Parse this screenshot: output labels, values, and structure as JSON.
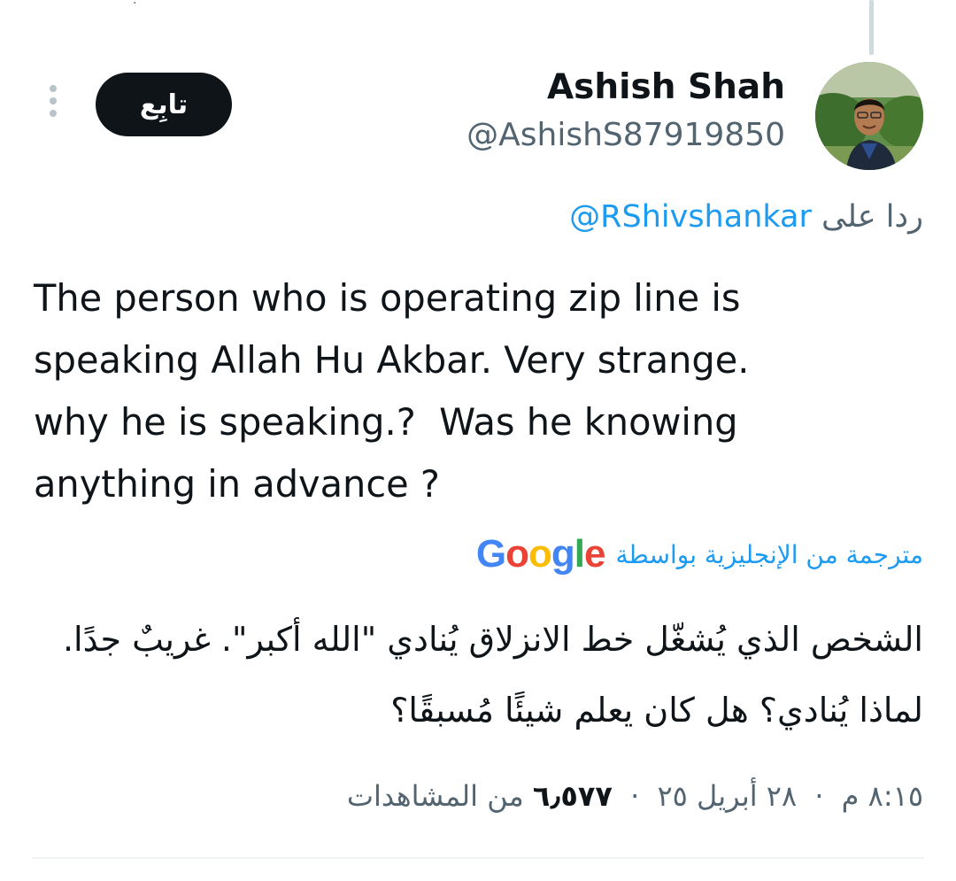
{
  "thread": {
    "top_mark": "·"
  },
  "author": {
    "name": "Ashish Shah",
    "handle": "@AshishS87919850",
    "avatar_icon": "profile-photo"
  },
  "actions": {
    "follow_label": "تابِع",
    "more_icon": "more-vertical-icon"
  },
  "reply": {
    "prefix": "ردا على",
    "handle": "@RShivshankar"
  },
  "tweet": {
    "text": "The person who is operating zip line is\nspeaking Allah Hu Akbar. Very strange.\nwhy he is speaking.?  Was he knowing\nanything in advance ?"
  },
  "translation": {
    "label": "مترجمة من الإنجليزية بواسطة",
    "provider": "Google",
    "text": "الشخص الذي يُشغّل خط الانزلاق يُنادي \"الله أكبر\". غريبٌ جدًا. لماذا يُنادي؟ هل كان يعلم شيئًا مُسبقًا؟"
  },
  "meta": {
    "time": "٨:١٥ م",
    "date": "٢٨ أبريل ٢٥",
    "views_count": "٦٫٥٧٧",
    "views_label": "من المشاهدات",
    "separator": "·"
  },
  "colors": {
    "link": "#1d9bf0",
    "secondary": "#536471",
    "primary": "#0f1419",
    "google_blue": "#4285f4",
    "google_red": "#ea4335",
    "google_yellow": "#fbbc05",
    "google_green": "#34a853"
  }
}
